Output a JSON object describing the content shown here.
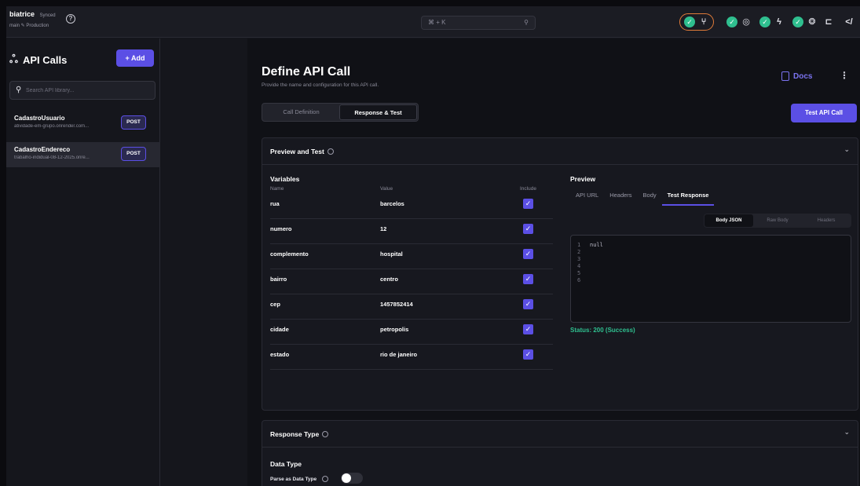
{
  "project": {
    "name": "biatrice",
    "sync_label": "Synced",
    "branch_label": "main ✎ Production"
  },
  "topbar": {
    "command_label": "⌘ + K",
    "search_icon": "search-icon",
    "help_icon": "help-circle-icon"
  },
  "sidebar": {
    "title": "API Calls",
    "add_label": "+ Add",
    "search_placeholder": "Search API library...",
    "items": [
      {
        "name": "CadastroUsuario",
        "url": "atividade-em-grupo.onrender.com...",
        "method": "POST"
      },
      {
        "name": "CadastroEndereco",
        "url": "trabalho-indidual-08-12-2025.onre...",
        "method": "POST"
      }
    ]
  },
  "main": {
    "title": "Define API Call",
    "subtitle": "Provide the name and configuration for this API call.",
    "docs_label": "Docs",
    "tabs": [
      "Call Definition",
      "Response & Test"
    ],
    "active_tab": 1,
    "test_button_label": "Test API Call"
  },
  "preview_panel": {
    "title": "Preview and Test",
    "variables_title": "Variables",
    "columns": {
      "name": "Name",
      "value": "Value",
      "include": "Include"
    },
    "variables": [
      {
        "name": "rua",
        "value": "barcelos",
        "include": true
      },
      {
        "name": "numero",
        "value": "12",
        "include": true
      },
      {
        "name": "complemento",
        "value": "hospital",
        "include": true
      },
      {
        "name": "bairro",
        "value": "centro",
        "include": true
      },
      {
        "name": "cep",
        "value": "1457852414",
        "include": true
      },
      {
        "name": "cidade",
        "value": "petropolis",
        "include": true
      },
      {
        "name": "estado",
        "value": "rio de janeiro",
        "include": true
      }
    ],
    "preview_title": "Preview",
    "preview_tabs": [
      "API URL",
      "Headers",
      "Body",
      "Test Response"
    ],
    "active_preview_tab": 3,
    "response_segments": [
      "Body JSON",
      "Raw Body",
      "Headers"
    ],
    "active_segment": 0,
    "code_line_numbers": "1\n2\n3\n4\n5\n6",
    "code_text": "null",
    "status_text": "Status: 200 (Success)"
  },
  "response_panel": {
    "title": "Response Type",
    "data_type_title": "Data Type",
    "parse_label": "Parse as Data Type",
    "parse_enabled": false
  },
  "colors": {
    "accent": "#5b4fe5",
    "success": "#2fbf8f",
    "background": "#101116"
  }
}
